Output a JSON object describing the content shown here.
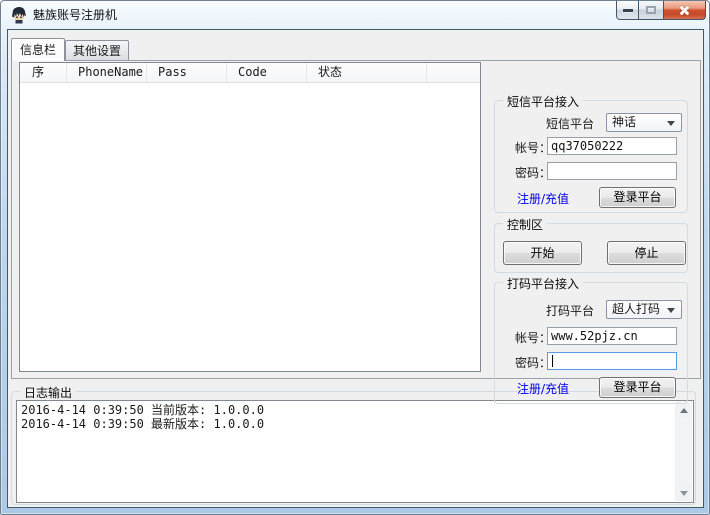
{
  "window": {
    "title": "魅族账号注册机"
  },
  "icons": {
    "app_icon": "anime-avatar",
    "minimize": "–",
    "maximize": "▢",
    "close": "✕",
    "dropdown_arrow": "▼",
    "scroll_up": "▲",
    "scroll_down": "▼",
    "text_caret": "|"
  },
  "tabs": [
    {
      "label": "信息栏",
      "active": true
    },
    {
      "label": "其他设置",
      "active": false
    }
  ],
  "list": {
    "columns": [
      "序",
      "PhoneName",
      "Pass",
      "Code",
      "状态"
    ],
    "rows": []
  },
  "sms": {
    "title": "短信平台接入",
    "platform_label": "短信平台",
    "platform_value": "神话",
    "account_label": "帐号：",
    "account_value": "qq37050222",
    "password_label": "密码：",
    "password_value": "",
    "register_link": "注册/充值",
    "login_button": "登录平台"
  },
  "control": {
    "title": "控制区",
    "start_button": "开始",
    "stop_button": "停止"
  },
  "captcha": {
    "title": "打码平台接入",
    "platform_label": "打码平台",
    "platform_value": "超人打码",
    "account_label": "帐号：",
    "account_value": "www.52pjz.cn",
    "password_label": "密码：",
    "password_value": "",
    "register_link": "注册/充值",
    "login_button": "登录平台"
  },
  "log": {
    "title": "日志输出",
    "lines": [
      "2016-4-14 0:39:50 当前版本: 1.0.0.0",
      "2016-4-14 0:39:50 最新版本: 1.0.0.0"
    ]
  },
  "colors": {
    "link": "#0000ee",
    "close_button_red": "#cf5230",
    "focused_input_border": "#569de5",
    "titlebar_glass": "#bdd7ee",
    "client_bg": "#f0f0f0"
  }
}
